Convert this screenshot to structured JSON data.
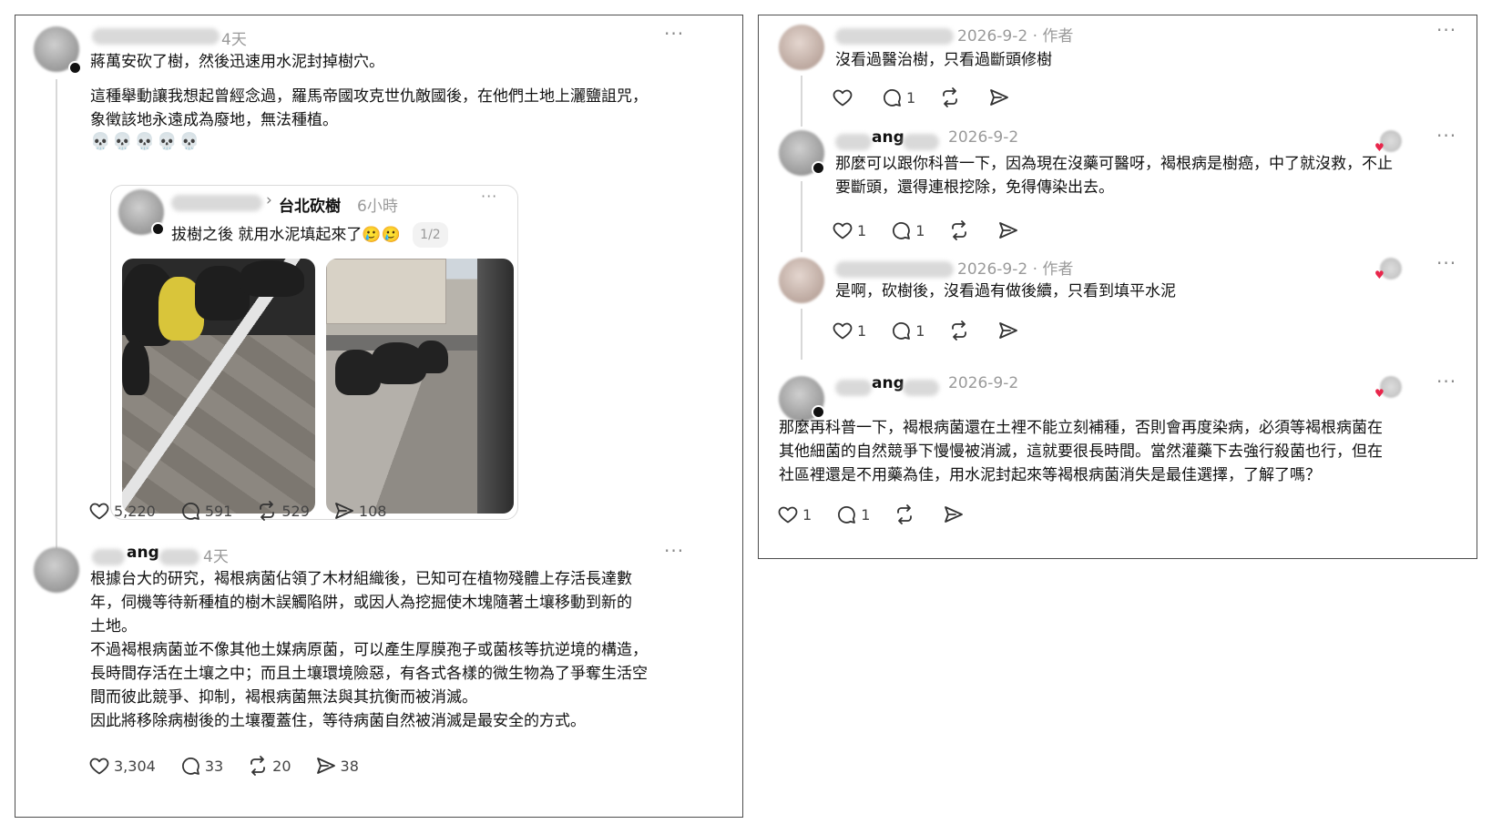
{
  "left": {
    "post1": {
      "time": "4天",
      "more": "···",
      "text_lines": [
        "蔣萬安砍了樹，然後迅速用水泥封掉樹穴。"
      ],
      "body_lines": [
        "這種舉動讓我想起曾經念過，羅馬帝國攻克世仇敵國後，在他們土地上灑鹽詛咒，",
        "象徵該地永遠成為廢地，無法種植。"
      ],
      "emoji": "💀💀💀💀💀",
      "quote": {
        "chevron": "›",
        "topic": "台北砍樹",
        "time": "6小時",
        "more": "···",
        "text": "拔樹之後 就用水泥填起來了🥲🥲",
        "counter": "1/2"
      },
      "actions": {
        "likes": "5,220",
        "replies": "591",
        "reposts": "529",
        "shares": "108"
      }
    },
    "post2": {
      "name_visible": "ang",
      "time": "4天",
      "more": "···",
      "lines": [
        "根據台大的研究，褐根病菌佔領了木材組織後，已知可在植物殘體上存活長達數",
        "年，伺機等待新種植的樹木誤觸陷阱，或因人為挖掘使木塊隨著土壤移動到新的",
        "土地。",
        "不過褐根病菌並不像其他土媒病原菌，可以產生厚膜孢子或菌核等抗逆境的構造，",
        "長時間存活在土壤之中；而且土壤環境險惡，有各式各樣的微生物為了爭奪生活空",
        "間而彼此競爭、抑制，褐根病菌無法與其抗衡而被消滅。",
        "因此將移除病樹後的土壤覆蓋住，等待病菌自然被消滅是最安全的方式。"
      ],
      "actions": {
        "likes": "3,304",
        "replies": "33",
        "reposts": "20",
        "shares": "38"
      }
    }
  },
  "right": {
    "reply1": {
      "time": "2026-9-2",
      "author_tag": "· 作者",
      "more": "···",
      "text": "沒看過醫治樹，只看過斷頭修樹",
      "actions": {
        "likes": "",
        "replies": "1"
      }
    },
    "reply2": {
      "name_visible": "ang",
      "time": "2026-9-2",
      "more": "···",
      "lines": [
        "那麼可以跟你科普一下，因為現在沒藥可醫呀，褐根病是樹癌，中了就沒救，不止",
        "要斷頭，還得連根挖除，免得傳染出去。"
      ],
      "actions": {
        "likes": "1",
        "replies": "1"
      }
    },
    "reply3": {
      "time": "2026-9-2",
      "author_tag": "· 作者",
      "more": "···",
      "text": "是啊，砍樹後，沒看過有做後續，只看到填平水泥",
      "actions": {
        "likes": "1",
        "replies": "1"
      }
    },
    "reply4": {
      "name_visible": "ang",
      "time": "2026-9-2",
      "more": "···",
      "lines": [
        "那麼再科普一下，褐根病菌還在土裡不能立刻補種，否則會再度染病，必須等褐根病菌在",
        "其他細菌的自然競爭下慢慢被消滅，這就要很長時間。當然灌藥下去強行殺菌也行，但在",
        "社區裡還是不用藥為佳，用水泥封起來等褐根病菌消失是最佳選擇，了解了嗎？"
      ],
      "actions": {
        "likes": "1",
        "replies": "1"
      }
    }
  },
  "colors": {
    "like_heart": "#e8264b",
    "muted": "#9a9a9a",
    "border": "#4d4d4d"
  },
  "icons": [
    "heart-icon",
    "comment-icon",
    "repost-icon",
    "share-icon",
    "more-icon"
  ]
}
